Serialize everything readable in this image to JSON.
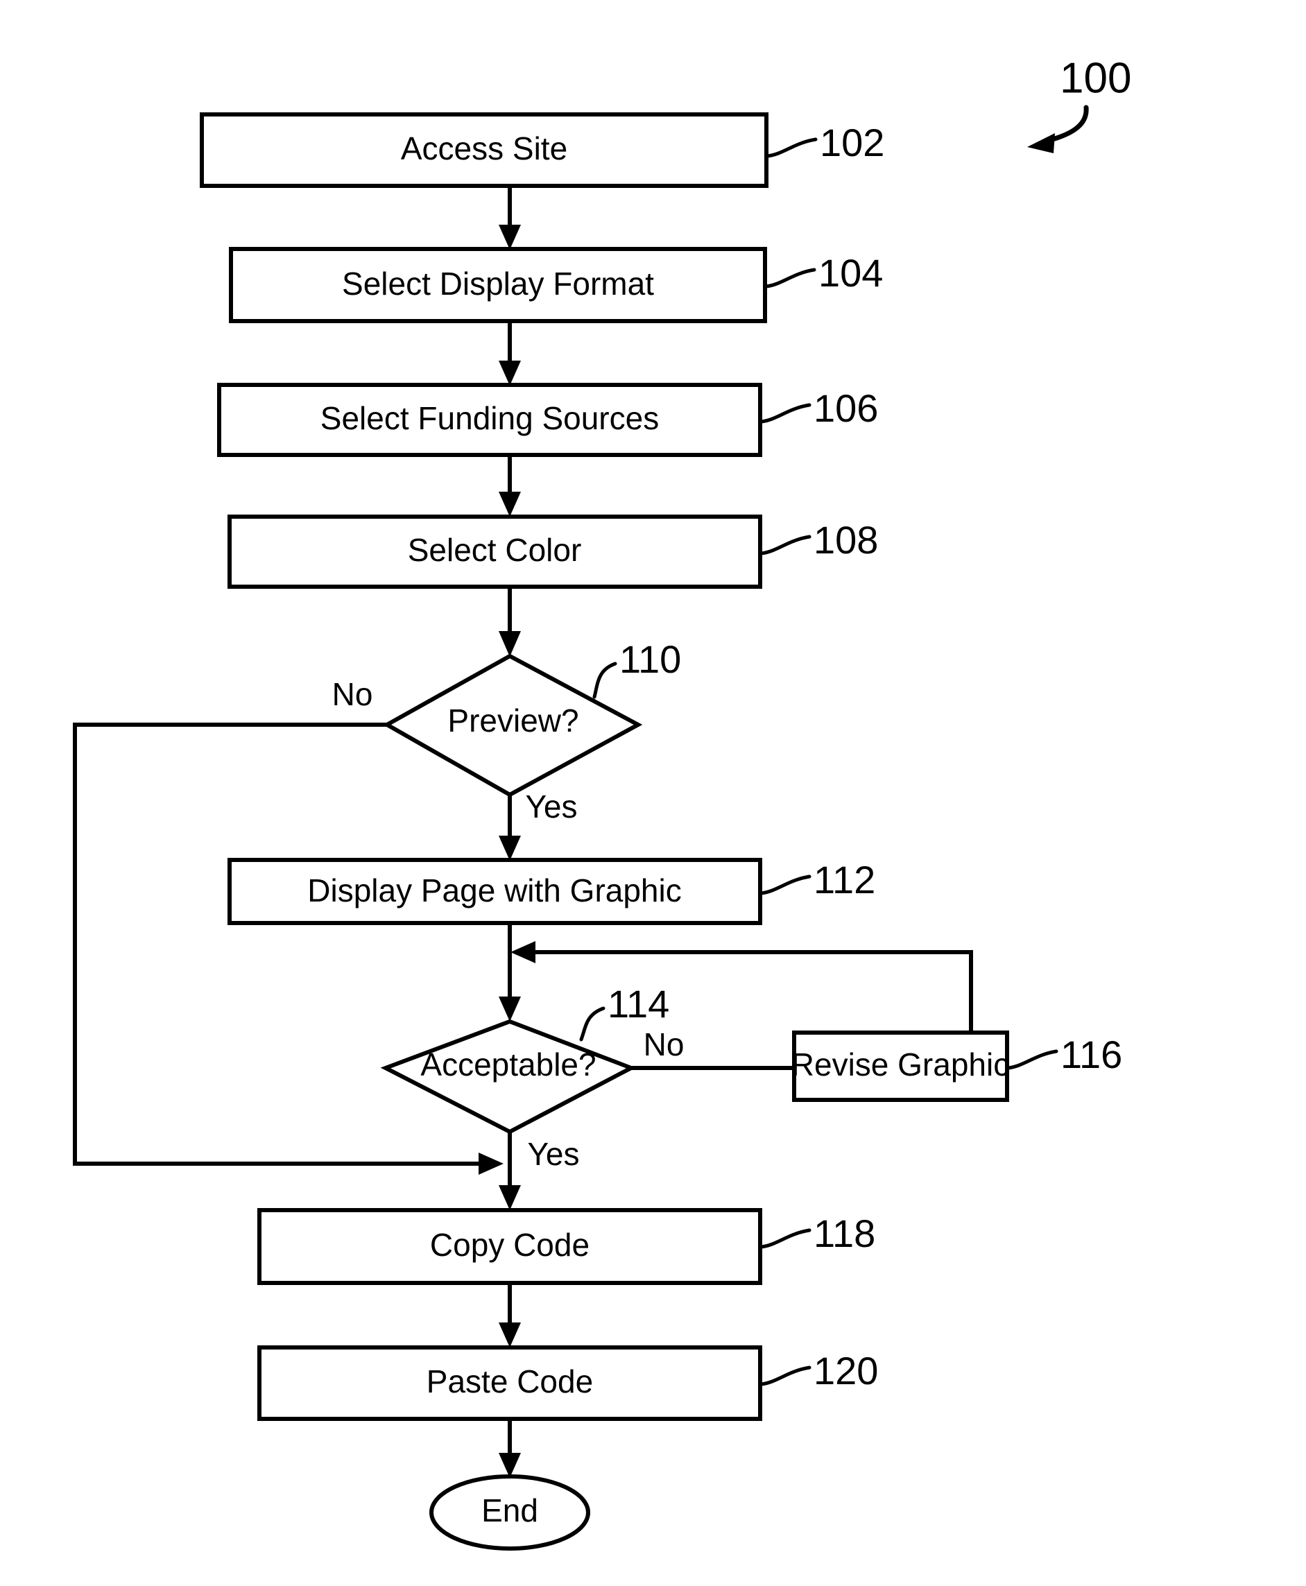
{
  "figure": {
    "number": "100",
    "type": "flowchart",
    "background_color": "#ffffff",
    "line_color": "#000000"
  },
  "nodes": [
    {
      "id": "n102",
      "shape": "process",
      "label": "Access Site",
      "ref": "102"
    },
    {
      "id": "n104",
      "shape": "process",
      "label": "Select Display Format",
      "ref": "104"
    },
    {
      "id": "n106",
      "shape": "process",
      "label": "Select Funding Sources",
      "ref": "106"
    },
    {
      "id": "n108",
      "shape": "process",
      "label": "Select Color",
      "ref": "108"
    },
    {
      "id": "n110",
      "shape": "decision",
      "label": "Preview?",
      "ref": "110"
    },
    {
      "id": "n112",
      "shape": "process",
      "label": "Display Page with Graphic",
      "ref": "112"
    },
    {
      "id": "n114",
      "shape": "decision",
      "label": "Acceptable?",
      "ref": "114"
    },
    {
      "id": "n116",
      "shape": "process",
      "label": "Revise Graphic",
      "ref": "116"
    },
    {
      "id": "n118",
      "shape": "process",
      "label": "Copy Code",
      "ref": "118"
    },
    {
      "id": "n120",
      "shape": "process",
      "label": "Paste Code",
      "ref": "120"
    },
    {
      "id": "nEnd",
      "shape": "terminal",
      "label": "End",
      "ref": ""
    }
  ],
  "edge_labels": {
    "preview_no": "No",
    "preview_yes": "Yes",
    "acceptable_no": "No",
    "acceptable_yes": "Yes"
  },
  "edges": [
    {
      "from": "n102",
      "to": "n104",
      "label": ""
    },
    {
      "from": "n104",
      "to": "n106",
      "label": ""
    },
    {
      "from": "n106",
      "to": "n108",
      "label": ""
    },
    {
      "from": "n108",
      "to": "n110",
      "label": ""
    },
    {
      "from": "n110",
      "to": "n112",
      "label": "Yes"
    },
    {
      "from": "n110",
      "to": "n118",
      "label": "No"
    },
    {
      "from": "n112",
      "to": "n114",
      "label": ""
    },
    {
      "from": "n114",
      "to": "n116",
      "label": "No"
    },
    {
      "from": "n114",
      "to": "n118",
      "label": "Yes"
    },
    {
      "from": "n116",
      "to": "n114",
      "label": ""
    },
    {
      "from": "n118",
      "to": "n120",
      "label": ""
    },
    {
      "from": "n120",
      "to": "nEnd",
      "label": ""
    }
  ]
}
